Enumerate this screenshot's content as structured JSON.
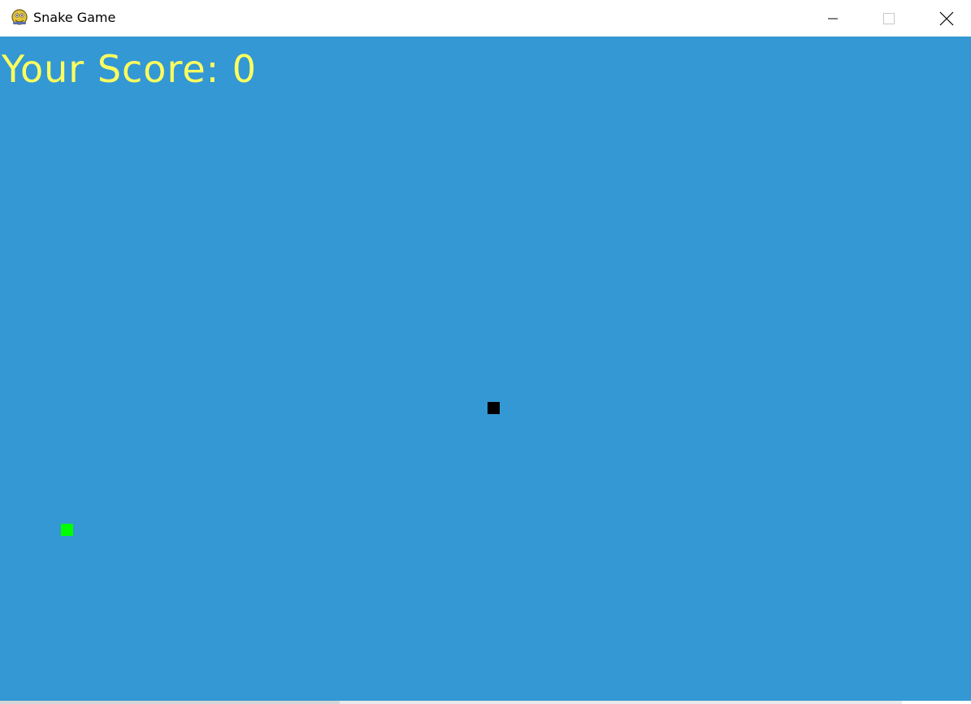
{
  "window": {
    "title": "Snake Game",
    "app_icon": "pygame-snake-icon",
    "controls": {
      "minimize_icon": "minimize-icon",
      "maximize_icon": "maximize-icon",
      "close_icon": "close-icon"
    }
  },
  "game": {
    "score_text": "Your Score: 0",
    "score": 0,
    "colors": {
      "background": "#3498d4",
      "score_text": "#fefe5f",
      "snake": "#000000",
      "food": "#00ff00"
    }
  }
}
